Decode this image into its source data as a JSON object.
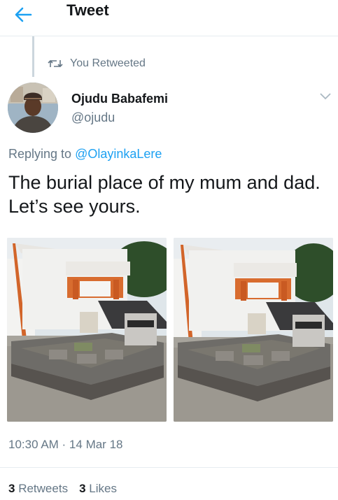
{
  "header": {
    "title": "Tweet",
    "back_icon": "arrow-left-icon"
  },
  "retweet": {
    "label": "You Retweeted",
    "icon": "retweet-icon"
  },
  "author": {
    "name": "Ojudu Babafemi",
    "handle": "@ojudu"
  },
  "reply": {
    "prefix": "Replying to ",
    "to": "@OlayinkaLere"
  },
  "tweet": {
    "text": "The burial place of my mum and dad. Let’s see yours."
  },
  "meta": {
    "timestamp": "10:30 AM · 14 Mar 18"
  },
  "stats": {
    "retweets_count": "3",
    "retweets_label": "Retweets",
    "likes_count": "3",
    "likes_label": "Likes"
  },
  "colors": {
    "accent": "#1da1f2",
    "secondary": "#657786"
  }
}
